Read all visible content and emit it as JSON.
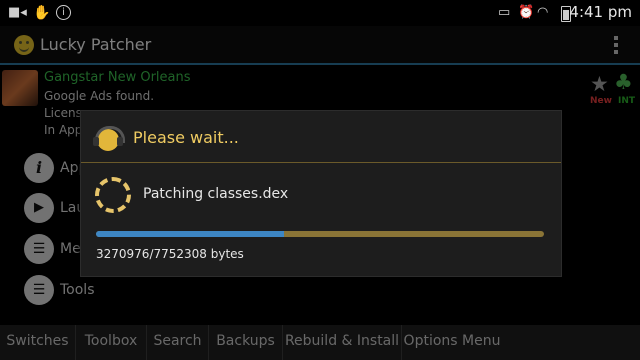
{
  "status_bar": {
    "time": "4:41 pm",
    "left_icons": [
      "video-camera-icon",
      "hand-icon",
      "info-icon"
    ],
    "right_icons": [
      "cast-icon",
      "alarm-icon",
      "wifi-icon",
      "battery-icon"
    ]
  },
  "app_bar": {
    "title": "Lucky Patcher",
    "menu_icon": "overflow-menu-icon"
  },
  "app_entry": {
    "name": "Gangstar New Orleans",
    "line1": "Google Ads found.",
    "line2": "Licens...",
    "line3": "In App...",
    "badge_new": "New",
    "badge_int": "INT"
  },
  "menu": {
    "items": [
      {
        "label": "App",
        "icon": "info-icon"
      },
      {
        "label": "Lau",
        "icon": "play-icon"
      },
      {
        "label": "Me",
        "icon": "list-icon"
      },
      {
        "label": "Tools",
        "icon": "list-icon"
      }
    ]
  },
  "bottom_bar": {
    "buttons": [
      "Switches",
      "Toolbox",
      "Search",
      "Backups",
      "Rebuild & Install",
      "Options Menu"
    ]
  },
  "dialog": {
    "title": "Please wait...",
    "message": "Patching classes.dex",
    "bytes": "3270976/7752308 bytes",
    "progress_fraction": 0.42,
    "accent_color": "#f0cc62",
    "progress_color": "#3d86c4"
  }
}
